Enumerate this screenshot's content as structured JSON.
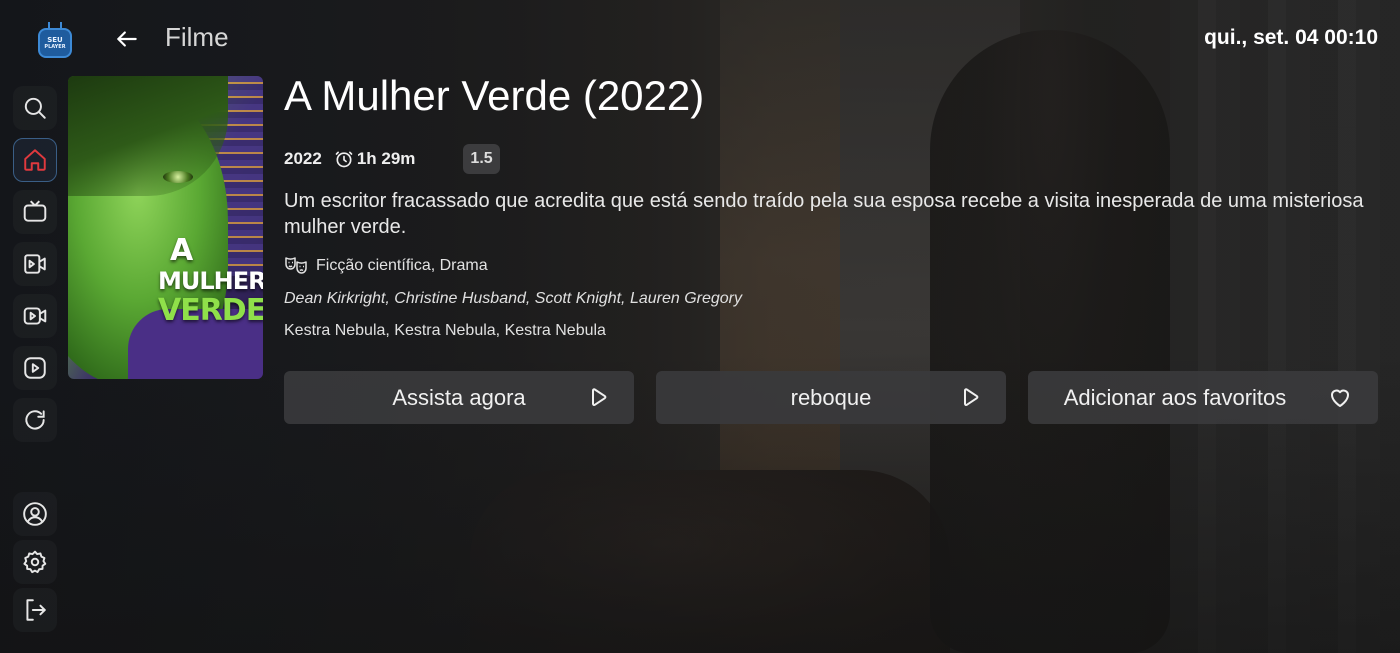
{
  "app": {
    "logo_line1": "SEU",
    "logo_line2": "PLAYER"
  },
  "header": {
    "section_title": "Filme",
    "datetime": "qui., set. 04  00:10"
  },
  "sidebar": {
    "items": [
      {
        "icon": "search-icon"
      },
      {
        "icon": "home-icon",
        "active": true
      },
      {
        "icon": "tv-icon"
      },
      {
        "icon": "movies-icon"
      },
      {
        "icon": "series-icon"
      },
      {
        "icon": "play-icon"
      },
      {
        "icon": "refresh-icon"
      },
      {
        "icon": "profile-icon"
      },
      {
        "icon": "settings-icon"
      },
      {
        "icon": "logout-icon"
      }
    ],
    "active_color": "#d93a3a"
  },
  "movie": {
    "title": "A Mulher Verde (2022)",
    "year": "2022",
    "duration": "1h 29m",
    "rating": "1.5",
    "description": "Um escritor fracassado que acredita que está sendo traído pela sua esposa recebe a visita inesperada de uma misteriosa mulher verde.",
    "genres": "Ficção científica, Drama",
    "cast": "Dean Kirkright, Christine Husband, Scott Knight, Lauren Gregory",
    "director": "Kestra Nebula, Kestra Nebula, Kestra Nebula",
    "poster": {
      "title_line1": "A",
      "title_line2": "MULHER",
      "title_line3": "VERDE"
    }
  },
  "actions": {
    "watch_label": "Assista agora",
    "trailer_label": "reboque",
    "favorite_label": "Adicionar aos favoritos"
  }
}
